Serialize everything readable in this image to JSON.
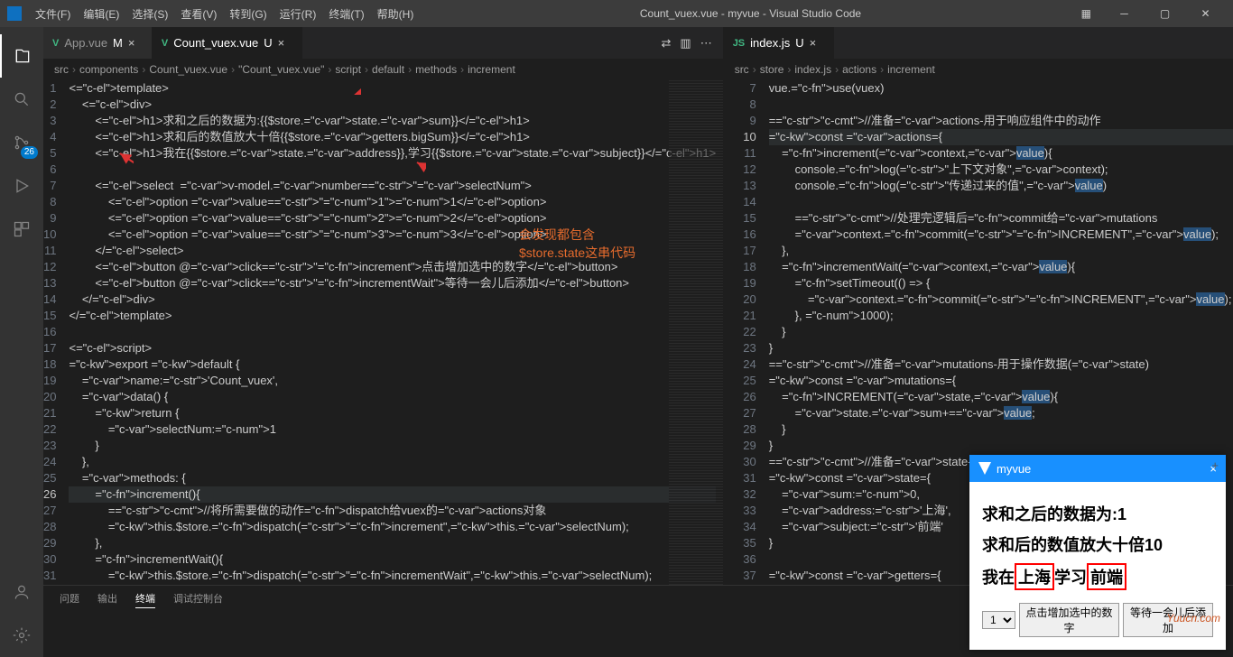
{
  "title": "Count_vuex.vue - myvue - Visual Studio Code",
  "menu": [
    "文件(F)",
    "编辑(E)",
    "选择(S)",
    "查看(V)",
    "转到(G)",
    "运行(R)",
    "终端(T)",
    "帮助(H)"
  ],
  "scm_badge": "26",
  "left": {
    "tabs": [
      {
        "icon": "V",
        "name": "App.vue",
        "mod": "M",
        "active": false
      },
      {
        "icon": "V",
        "name": "Count_vuex.vue",
        "mod": "U",
        "active": true
      }
    ],
    "breadcrumb": [
      "src",
      "components",
      "Count_vuex.vue",
      "\"Count_vuex.vue\"",
      "script",
      "default",
      "methods",
      "increment"
    ],
    "linesStart": 1,
    "currentLine": 26,
    "code": [
      "<template>",
      "    <div>",
      "        <h1>求和之后的数据为:{{$store.state.sum}}</h1>",
      "        <h1>求和后的数值放大十倍{{$store.getters.bigSum}}</h1>",
      "        <h1>我在{{$store.state.address}},学习{{$store.state.subject}}</h1>",
      "",
      "        <select  v-model.number=\"selectNum\">",
      "            <option value=\"1\">1</option>",
      "            <option value=\"2\">2</option>",
      "            <option value=\"3\">3</option>",
      "        </select>",
      "        <button @click=\"increment\">点击增加选中的数字</button>",
      "        <button @click=\"incrementWait\">等待一会儿后添加</button>",
      "    </div>",
      "</template>",
      "",
      "<script>",
      "export default {",
      "    name:'Count_vuex',",
      "    data() {",
      "        return {",
      "            selectNum:1",
      "        }",
      "    },",
      "    methods: {",
      "        increment(){",
      "            //将所需要做的动作dispatch给vuex的actions对象",
      "            this.$store.dispatch(\"increment\",this.selectNum);",
      "        },",
      "        incrementWait(){",
      "            this.$store.dispatch(\"incrementWait\",this.selectNum);"
    ]
  },
  "right": {
    "tabs": [
      {
        "icon": "JS",
        "name": "index.js",
        "mod": "U",
        "active": true
      }
    ],
    "breadcrumb": [
      "src",
      "store",
      "index.js",
      "actions",
      "increment"
    ],
    "linesStart": 7,
    "currentLine": 10,
    "highlight": "value",
    "code": [
      "vue.use(vuex)",
      "",
      "//准备actions-用于响应组件中的动作",
      "const actions={",
      "    increment(context,value){",
      "        console.log(\"上下文对象\",context);",
      "        console.log(\"传递过来的值\",value)",
      "",
      "        //处理完逻辑后commit给mutations",
      "        context.commit(\"INCREMENT\",value);",
      "    },",
      "    incrementWait(context,value){",
      "        setTimeout(() => {",
      "            context.commit(\"INCREMENT\",value);",
      "        }, 1000);",
      "    }",
      "}",
      "//准备mutations-用于操作数据(state)",
      "const mutations={",
      "    INCREMENT(state,value){",
      "        state.sum+=value;",
      "    }",
      "}",
      "//准备state-用于存储数据",
      "const state={",
      "    sum:0,",
      "    address:'上海',",
      "    subject:'前端'",
      "}",
      "",
      "const getters={"
    ]
  },
  "anno": {
    "l1": "会发现都包含",
    "l2": "$store.state这串代码"
  },
  "panel": {
    "tabs": [
      "问题",
      "输出",
      "终端",
      "调试控制台"
    ],
    "active": "终端"
  },
  "popup": {
    "title": "myvue",
    "h1": "求和之后的数据为:1",
    "h2": "求和后的数值放大十倍10",
    "h3_pre": "我在",
    "h3_b1": "上海",
    "h3_mid": "学习",
    "h3_b2": "前端",
    "sel": "1",
    "btn1": "点击增加选中的数字",
    "btn2": "等待一会儿后添加"
  },
  "watermark": "Yuucn.com"
}
